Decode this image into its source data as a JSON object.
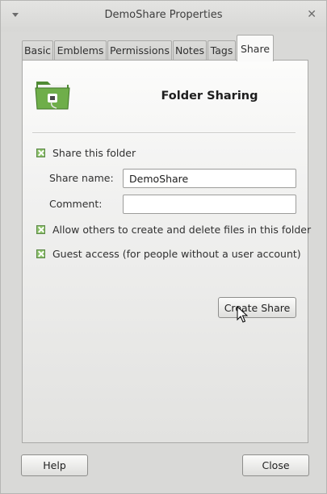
{
  "window": {
    "title": "DemoShare Properties"
  },
  "tabs": [
    {
      "label": "Basic"
    },
    {
      "label": "Emblems"
    },
    {
      "label": "Permissions"
    },
    {
      "label": "Notes"
    },
    {
      "label": "Tags"
    },
    {
      "label": "Share",
      "active": true
    }
  ],
  "share": {
    "heading": "Folder Sharing",
    "share_folder": {
      "label": "Share this folder",
      "checked": true
    },
    "share_name": {
      "label": "Share name:",
      "value": "DemoShare"
    },
    "comment": {
      "label": "Comment:",
      "value": ""
    },
    "allow_others": {
      "label": "Allow others to create and delete files in this folder",
      "checked": true
    },
    "guest_access": {
      "label": "Guest access (for people without a user account)",
      "checked": true
    },
    "create_button": "Create Share"
  },
  "footer": {
    "help_button": "Help",
    "close_button": "Close"
  },
  "icons": {
    "folder": "folder-share-icon",
    "window_menu": "window-menu-icon",
    "close": "close-icon",
    "cursor": "mouse-pointer-icon"
  },
  "colors": {
    "checkbox": "#8bc068",
    "folder": "#6fae4a"
  }
}
